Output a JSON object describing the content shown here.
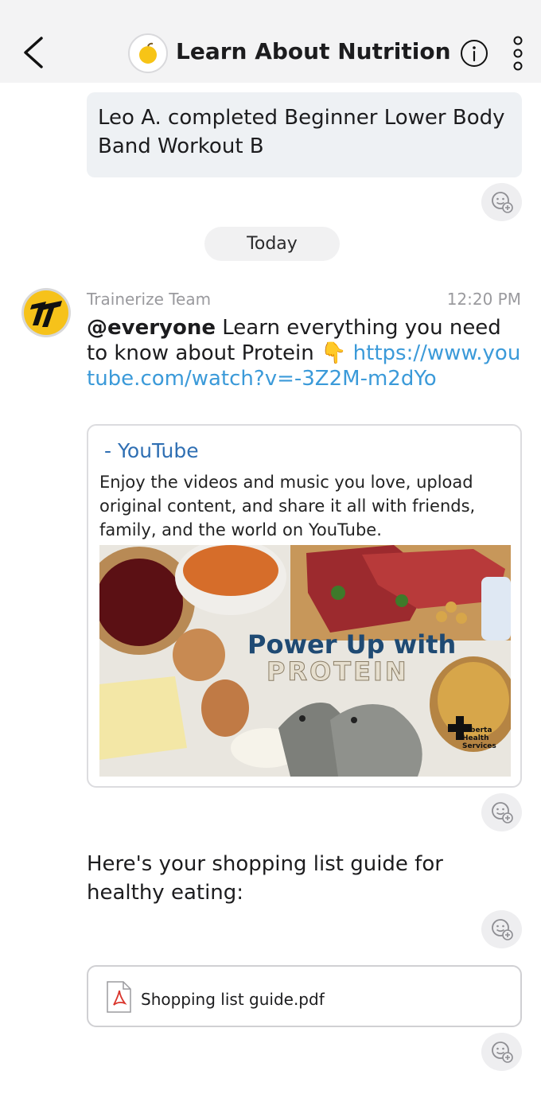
{
  "header": {
    "title": "Learn About Nutrition",
    "back_icon": "chevron-left-icon",
    "group_icon": "apple-icon",
    "info_icon": "info-icon",
    "more_icon": "more-vertical-icon"
  },
  "activity": {
    "text": "Leo A. completed Beginner Lower Body Band Workout B"
  },
  "date_divider": "Today",
  "message": {
    "sender": "Trainerize Team",
    "time": "12:20 PM",
    "mention": "@everyone",
    "text": "Learn everything you need to know about Protein",
    "emoji": "👇",
    "link": "https://www.youtube.com/watch?v=-3Z2M-m2dYo",
    "link_preview": {
      "title": "- YouTube",
      "description": "Enjoy the videos and music you love, upload original content, and share it all with friends, family, and the world on YouTube.",
      "image_headline_1": "Power Up with",
      "image_headline_2": "PROTEIN",
      "image_logo_text": "Alberta Health Services"
    }
  },
  "message2": {
    "text": "Here's your shopping list guide for healthy eating:"
  },
  "attachment": {
    "file_name": "Shopping list guide.pdf",
    "icon": "pdf-file-icon"
  },
  "colors": {
    "link": "#3b9ad9",
    "preview_title": "#2f6fb3",
    "header_bg": "#f3f3f4",
    "brand_yellow": "#f6c21a"
  }
}
